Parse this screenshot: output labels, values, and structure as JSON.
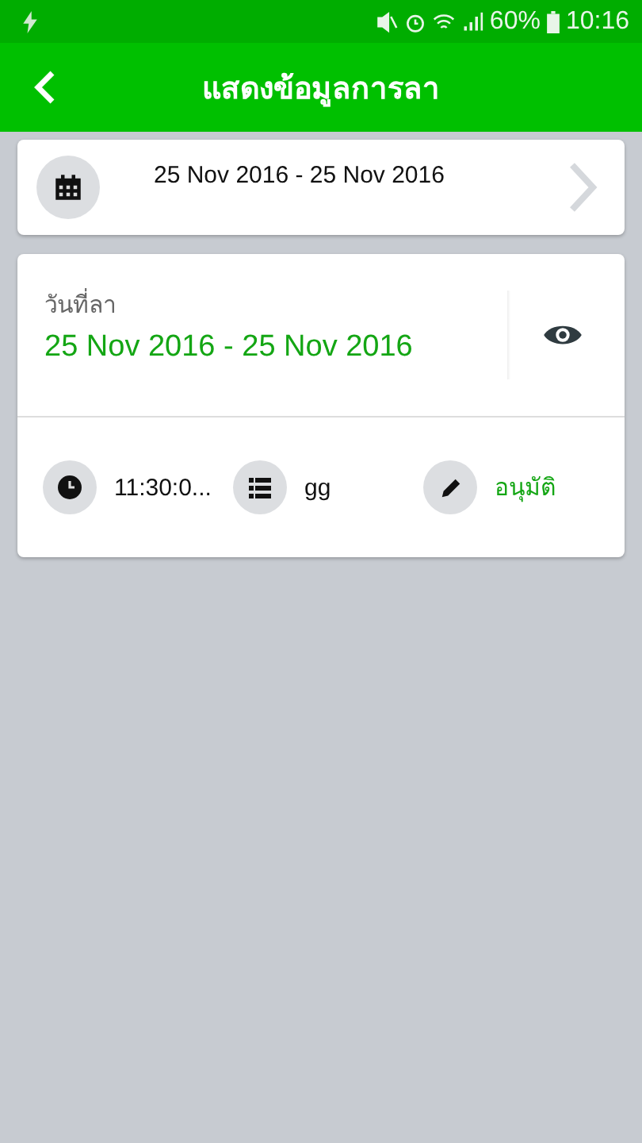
{
  "status_bar": {
    "battery": "60%",
    "time": "10:16"
  },
  "app_bar": {
    "title": "แสดงข้อมูลการลา"
  },
  "date_range_card": {
    "range": "25 Nov 2016 - 25 Nov 2016"
  },
  "leave_card": {
    "label": "วันที่ลา",
    "dates": "25 Nov 2016 - 25 Nov 2016",
    "details": [
      {
        "kind": "time",
        "text": "11:30:0..."
      },
      {
        "kind": "list",
        "text": "gg"
      },
      {
        "kind": "status",
        "text": "อนุมัติ"
      }
    ]
  }
}
